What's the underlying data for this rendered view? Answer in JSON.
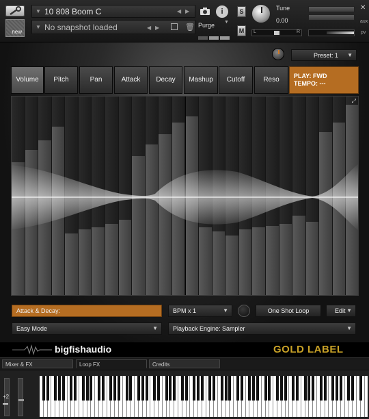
{
  "header": {
    "instrument_name": "10 808 Boom C",
    "snapshot": "No snapshot loaded",
    "new_label": "new",
    "purge_label": "Purge",
    "tune_label": "Tune",
    "tune_value": "0.00",
    "s_label": "S",
    "m_label": "M",
    "aux_label": "aux",
    "pv_label": "pv",
    "l_label": "L",
    "r_label": "R",
    "i_label": "i"
  },
  "preset": {
    "label": "Preset: 1"
  },
  "tabs": [
    {
      "label": "Volume",
      "active": true
    },
    {
      "label": "Pitch"
    },
    {
      "label": "Pan"
    },
    {
      "label": "Attack"
    },
    {
      "label": "Decay"
    },
    {
      "label": "Mashup"
    },
    {
      "label": "Cutoff"
    },
    {
      "label": "Reso"
    }
  ],
  "play_panel": {
    "line1": "PLAY: FWD",
    "line2": "TEMPO: ---"
  },
  "sequencer": {
    "levels": [
      0.67,
      0.73,
      0.78,
      0.85,
      0.31,
      0.33,
      0.34,
      0.36,
      0.38,
      0.7,
      0.76,
      0.81,
      0.87,
      0.9,
      0.34,
      0.32,
      0.3,
      0.33,
      0.34,
      0.35,
      0.36,
      0.4,
      0.37,
      0.82,
      0.87,
      0.96
    ]
  },
  "controls": {
    "attack_decay": "Attack & Decay:",
    "bpm": "BPM x 1",
    "one_shot": "One Shot Loop",
    "edit": "Edit",
    "mode": "Easy Mode",
    "engine": "Playback Engine: Sampler"
  },
  "branding": {
    "company": "bigfishaudio",
    "product": "GOLD LABEL"
  },
  "bottom_tabs": [
    {
      "label": "Mixer & FX"
    },
    {
      "label": "Loop FX",
      "active": true
    },
    {
      "label": "Credits"
    }
  ],
  "keyboard": {
    "octave": "+2"
  },
  "colors": {
    "accent": "#b56d22",
    "gold": "#c9a227"
  }
}
